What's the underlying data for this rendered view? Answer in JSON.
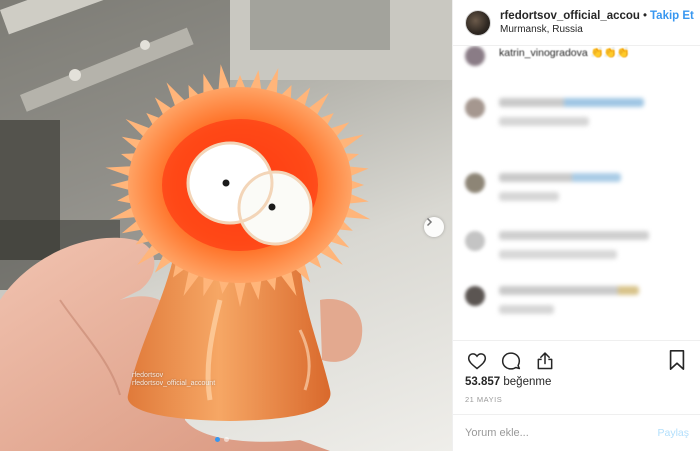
{
  "post": {
    "username": "rfedortsov_official_accou",
    "separator": "•",
    "follow_label": "Takip Et",
    "location": "Murmansk, Russia",
    "first_comment": "katrin_vinogradova 👏👏👏",
    "likes_count": "53.857",
    "likes_label": "beğenme",
    "date": "21 MAYIS",
    "comment_placeholder": "Yorum ekle...",
    "post_button": "Paylaş",
    "photo_watermark": [
      "rfedortsov",
      "rfedortsov_official_account"
    ]
  },
  "icons": {
    "like": "heart-icon",
    "comment": "comment-bubble-icon",
    "share": "share-icon",
    "save": "bookmark-icon",
    "next": "chevron-right-icon"
  },
  "carousel": {
    "slides": 2,
    "active": 1
  },
  "colors": {
    "accent": "#3897f0",
    "post_disabled": "#b2dffc",
    "muted": "#999999",
    "text": "#262626"
  }
}
